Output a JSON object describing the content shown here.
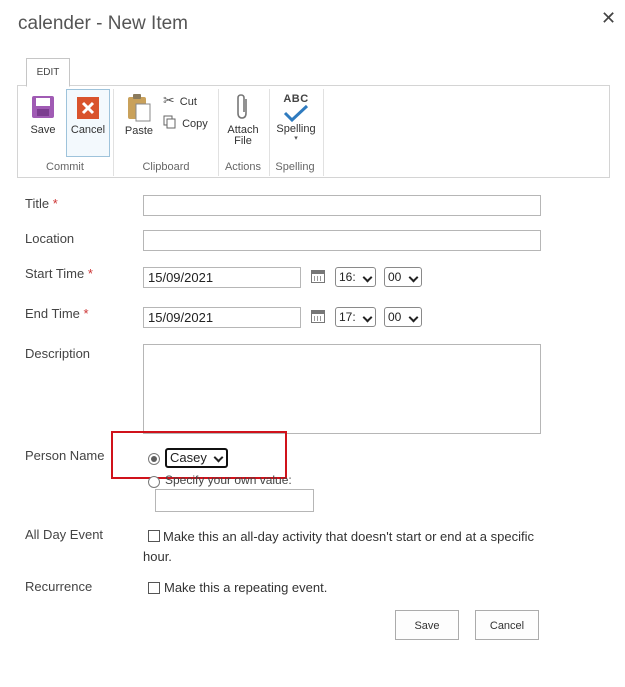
{
  "dialog": {
    "title": "calender - New Item",
    "close_glyph": "✕"
  },
  "ribbon": {
    "tab": "EDIT",
    "groups": {
      "commit": "Commit",
      "clipboard": "Clipboard",
      "actions": "Actions",
      "spelling": "Spelling"
    },
    "buttons": {
      "save": "Save",
      "cancel": "Cancel",
      "paste": "Paste",
      "cut": "Cut",
      "copy": "Copy",
      "attach_line1": "Attach",
      "attach_line2": "File",
      "spelling": "Spelling",
      "spelling_icon_text": "ABC"
    }
  },
  "form": {
    "title_label": "Title",
    "location_label": "Location",
    "start_label": "Start Time",
    "end_label": "End Time",
    "description_label": "Description",
    "person_label": "Person Name",
    "allday_label": "All Day Event",
    "recurrence_label": "Recurrence",
    "required_mark": "*",
    "start_date": "15/09/2021",
    "start_hour": "16:",
    "start_minute": "00",
    "end_date": "15/09/2021",
    "end_hour": "17:",
    "end_minute": "00",
    "person_selected": "Casey",
    "specify_label": "Specify your own value:",
    "allday_text": "Make this an all-day activity that doesn't start or end at a specific hour.",
    "recurrence_text": "Make this a repeating event."
  },
  "footer": {
    "save": "Save",
    "cancel": "Cancel"
  },
  "colors": {
    "highlight": "#d0121b",
    "save_icon": "#a05bb4",
    "cancel_icon": "#d9532c",
    "check_icon": "#2f7bbf"
  }
}
